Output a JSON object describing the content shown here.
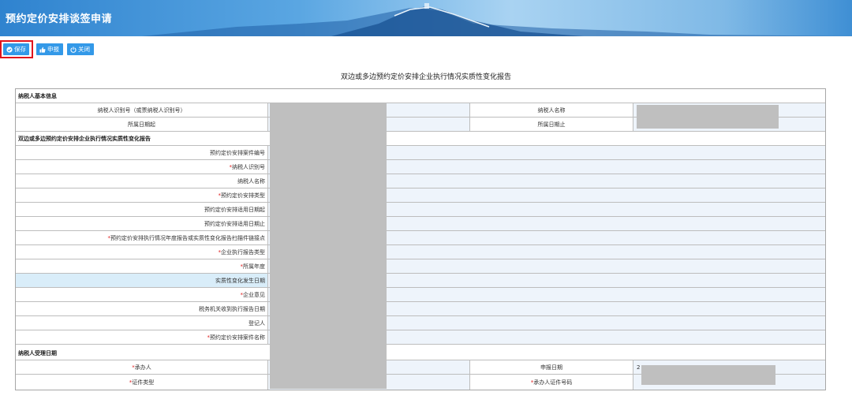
{
  "window": {
    "title": "预约定价安排谈签申请"
  },
  "toolbar": {
    "save": "保存",
    "submit": "申报",
    "close": "关闭"
  },
  "form": {
    "title": "双边或多边预约定价安排企业执行情况实质性变化报告",
    "section_basic": "纳税人基本信息",
    "basic": {
      "taxpayer_id_label": "纳税人识别号（或票纳税人识别号）",
      "taxpayer_name_label": "纳税人名称",
      "period_start_label": "所属日期起",
      "period_end_label": "所属日期止"
    },
    "section_report": "双边或多边预约定价安排企业执行情况实质性变化报告",
    "fields": [
      {
        "label": "预约定价安排案件编号",
        "required": ""
      },
      {
        "label": "纳税人识别号",
        "required": "*"
      },
      {
        "label": "纳税人名称",
        "required": ""
      },
      {
        "label": "预约定价安排类型",
        "required": "*"
      },
      {
        "label": "预约定价安排适用日期起",
        "required": ""
      },
      {
        "label": "预约定价安排适用日期止",
        "required": ""
      },
      {
        "label": "预约定价安排执行情况年度报告或实质性变化报告扫描件链接点",
        "required": "*"
      },
      {
        "label": "企业执行报告类型",
        "required": "*"
      },
      {
        "label": "所属年度",
        "required": "*"
      },
      {
        "label": "实质性变化发生日期",
        "required": ""
      },
      {
        "label": "企业意见",
        "required": "*"
      },
      {
        "label": "税务机关收到执行报告日期",
        "required": ""
      },
      {
        "label": "登记人",
        "required": ""
      },
      {
        "label": "预约定价安排案件名称",
        "required": "*"
      }
    ],
    "section_handling": "纳税人受理日期",
    "handling": {
      "handler_label": "承办人",
      "handler_required": "*",
      "report_date_label": "申报日期",
      "report_date_value": "2",
      "id_type_label": "证件类型",
      "id_type_required": "*",
      "id_number_label": "承办人证件号码",
      "id_number_required": "*"
    }
  },
  "colors": {
    "accent": "#3399e8",
    "highlight": "#e0141e",
    "input_bg": "#eef4fb"
  }
}
